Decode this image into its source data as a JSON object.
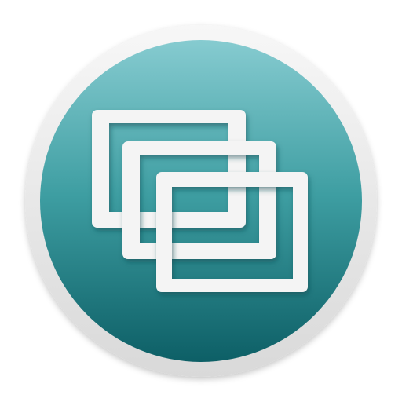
{
  "app_icon": {
    "icon_name": "stacked-windows-icon",
    "colors": {
      "outer_ring_light": "#f7f7f7",
      "outer_ring_dark": "#d9d9d9",
      "disc_top": "#86cbd0",
      "disc_mid": "#3e9ea2",
      "disc_bottom": "#0d5f66",
      "window_frame": "#f4f4f4",
      "window_frame_shadow": "#0b4d52"
    },
    "window_count": 3
  }
}
